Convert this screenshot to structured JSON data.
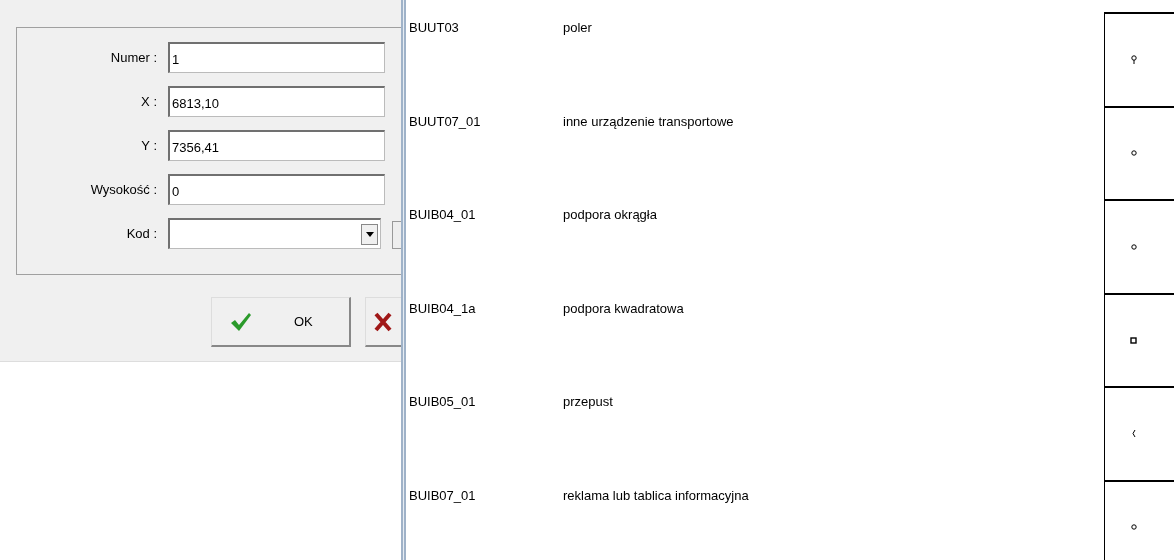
{
  "dialog": {
    "fields": [
      {
        "kind": "text",
        "label": "Numer :",
        "value": "1"
      },
      {
        "kind": "text",
        "label": "X :",
        "value": "6813,10"
      },
      {
        "kind": "text",
        "label": "Y :",
        "value": "7356,41"
      },
      {
        "kind": "text",
        "label": "Wysokość :",
        "value": "0"
      },
      {
        "kind": "dropdown",
        "label": "Kod :"
      }
    ],
    "buttons": [
      {
        "kind": "ok",
        "label": "OK"
      },
      {
        "kind": "cancel"
      }
    ]
  },
  "list": {
    "rows": [
      {
        "code": "BUUT03",
        "description": "poler",
        "kind": "pin"
      },
      {
        "code": "BUUT07_01",
        "description": "inne urządzenie transportowe",
        "kind": "circle"
      },
      {
        "code": "BUIB04_01",
        "description": "podpora okrągła",
        "kind": "circle"
      },
      {
        "code": "BUIB04_1a",
        "description": "podpora kwadratowa",
        "kind": "square"
      },
      {
        "code": "BUIB05_01",
        "description": "przepust",
        "kind": "bracket"
      },
      {
        "code": "BUIB07_01",
        "description": "reklama lub tablica informacyjna",
        "kind": "circle"
      }
    ]
  }
}
